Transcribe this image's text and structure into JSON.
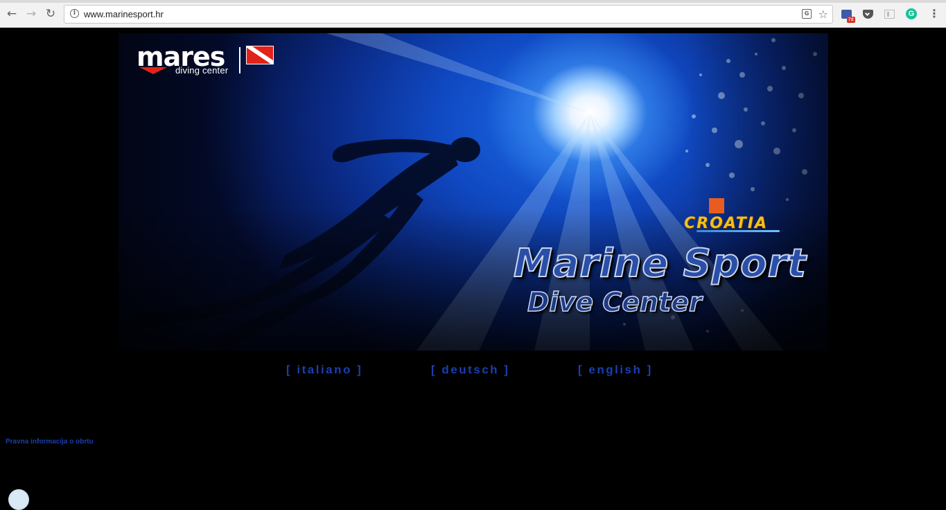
{
  "browser": {
    "url": "www.marinesport.hr",
    "back_icon": "←",
    "forward_icon": "→",
    "reload_icon": "↻",
    "info_icon": "i",
    "translate_icon": "G",
    "star_icon": "☆",
    "menu_icon": "⋮",
    "extensions": [
      {
        "name": "calendar-extension",
        "badge": "7d",
        "color": "#3a5ba8"
      },
      {
        "name": "pocket-extension",
        "color": "#555555"
      },
      {
        "name": "reader-extension",
        "color": "#bbbbbb"
      },
      {
        "name": "grammarly-extension",
        "label": "G",
        "color": "#15c39a"
      }
    ]
  },
  "banner": {
    "mares": {
      "brand": "mares",
      "subtitle": "diving center"
    },
    "croatia": "CROATIA",
    "title": "Marine Sport",
    "subtitle": "Dive Center"
  },
  "languages": [
    {
      "label": "[ italiano ]"
    },
    {
      "label": "[ deutsch ]"
    },
    {
      "label": "[ english ]"
    }
  ],
  "legal_link": "Pravna informacija o obrtu",
  "colors": {
    "link": "#1a3fae",
    "page_background": "#000000",
    "banner_blue": "#1049c2",
    "sun": "#ffffff",
    "croatia_gold": "#f3c11a",
    "dive_flag_red": "#e2231a"
  }
}
